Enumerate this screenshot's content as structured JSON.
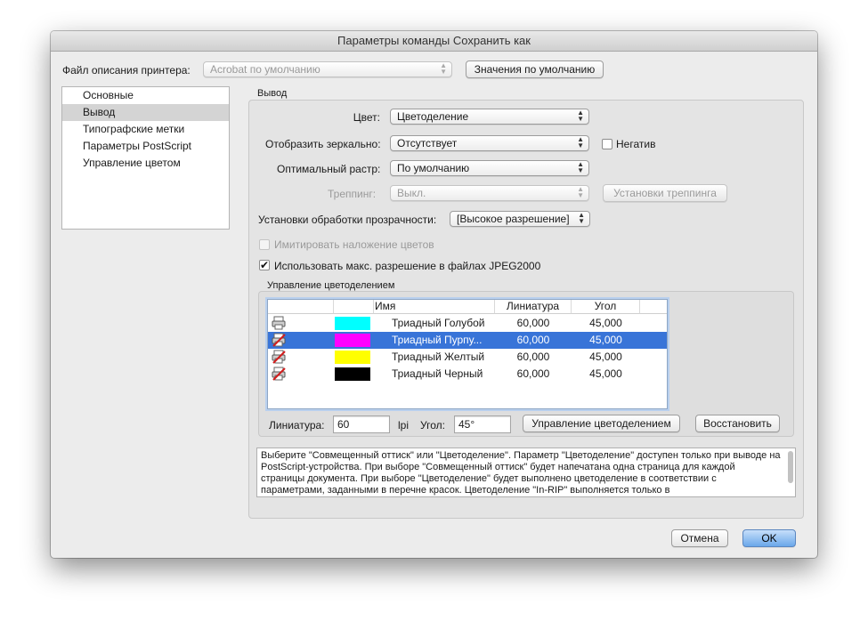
{
  "window": {
    "title": "Параметры команды Сохранить как"
  },
  "printer": {
    "label": "Файл описания принтера:",
    "value": "Acrobat по умолчанию",
    "defaults_button": "Значения по умолчанию"
  },
  "sidebar": {
    "items": [
      {
        "label": "Основные",
        "selected": false
      },
      {
        "label": "Вывод",
        "selected": true
      },
      {
        "label": "Типографские метки",
        "selected": false
      },
      {
        "label": "Параметры PostScript",
        "selected": false
      },
      {
        "label": "Управление цветом",
        "selected": false
      }
    ]
  },
  "output": {
    "section_title": "Вывод",
    "color": {
      "label": "Цвет:",
      "value": "Цветоделение"
    },
    "mirror": {
      "label": "Отобразить зеркально:",
      "value": "Отсутствует"
    },
    "negative": {
      "label": "Негатив",
      "checked": false
    },
    "screening": {
      "label": "Оптимальный растр:",
      "value": "По умолчанию"
    },
    "trapping": {
      "label": "Треппинг:",
      "value": "Выкл.",
      "disabled": true,
      "button": "Установки треппинга"
    },
    "transparency": {
      "label": "Установки обработки прозрачности:",
      "value": "[Высокое разрешение]"
    },
    "simulate_overprint": {
      "label": "Имитировать наложение цветов",
      "checked": false,
      "disabled": true
    },
    "max_jpeg2000": {
      "label": "Использовать макс. разрешение в файлах JPEG2000",
      "checked": true
    }
  },
  "separations": {
    "title": "Управление цветоделением",
    "columns": {
      "name": "Имя",
      "frequency": "Линиатура",
      "angle": "Угол"
    },
    "rows": [
      {
        "name": "Триадный Голубой",
        "frequency": "60,000",
        "angle": "45,000",
        "color": "#00ffff",
        "icon": "printer-icon",
        "selected": false
      },
      {
        "name": "Триадный Пурпу...",
        "frequency": "60,000",
        "angle": "45,000",
        "color": "#ff00ff",
        "icon": "printer-disabled-icon",
        "selected": true
      },
      {
        "name": "Триадный Желтый",
        "frequency": "60,000",
        "angle": "45,000",
        "color": "#ffff00",
        "icon": "printer-disabled-icon",
        "selected": false
      },
      {
        "name": "Триадный Черный",
        "frequency": "60,000",
        "angle": "45,000",
        "color": "#000000",
        "icon": "printer-disabled-icon",
        "selected": false
      }
    ],
    "frequency_label": "Линиатура:",
    "frequency_value": "60",
    "frequency_unit": "lpi",
    "angle_label": "Угол:",
    "angle_value": "45°",
    "manage_button": "Управление цветоделением",
    "restore_button": "Восстановить"
  },
  "description": "Выберите \"Совмещенный оттиск\" или \"Цветоделение\". Параметр \"Цветоделение\" доступен только при выводе на PostScript-устройства. При выборе \"Совмещенный оттиск\" будет напечатана одна страница для каждой страницы документа. При выборе \"Цветоделение\" будет выполнено цветоделение в соответствии с параметрами, заданными в перечне красок. Цветоделение \"In-RIP\" выполняется только в",
  "footer": {
    "cancel": "Отмена",
    "ok": "OK"
  },
  "colors": {
    "selection": "#3874d8",
    "default_button": "#6aa7ea"
  }
}
